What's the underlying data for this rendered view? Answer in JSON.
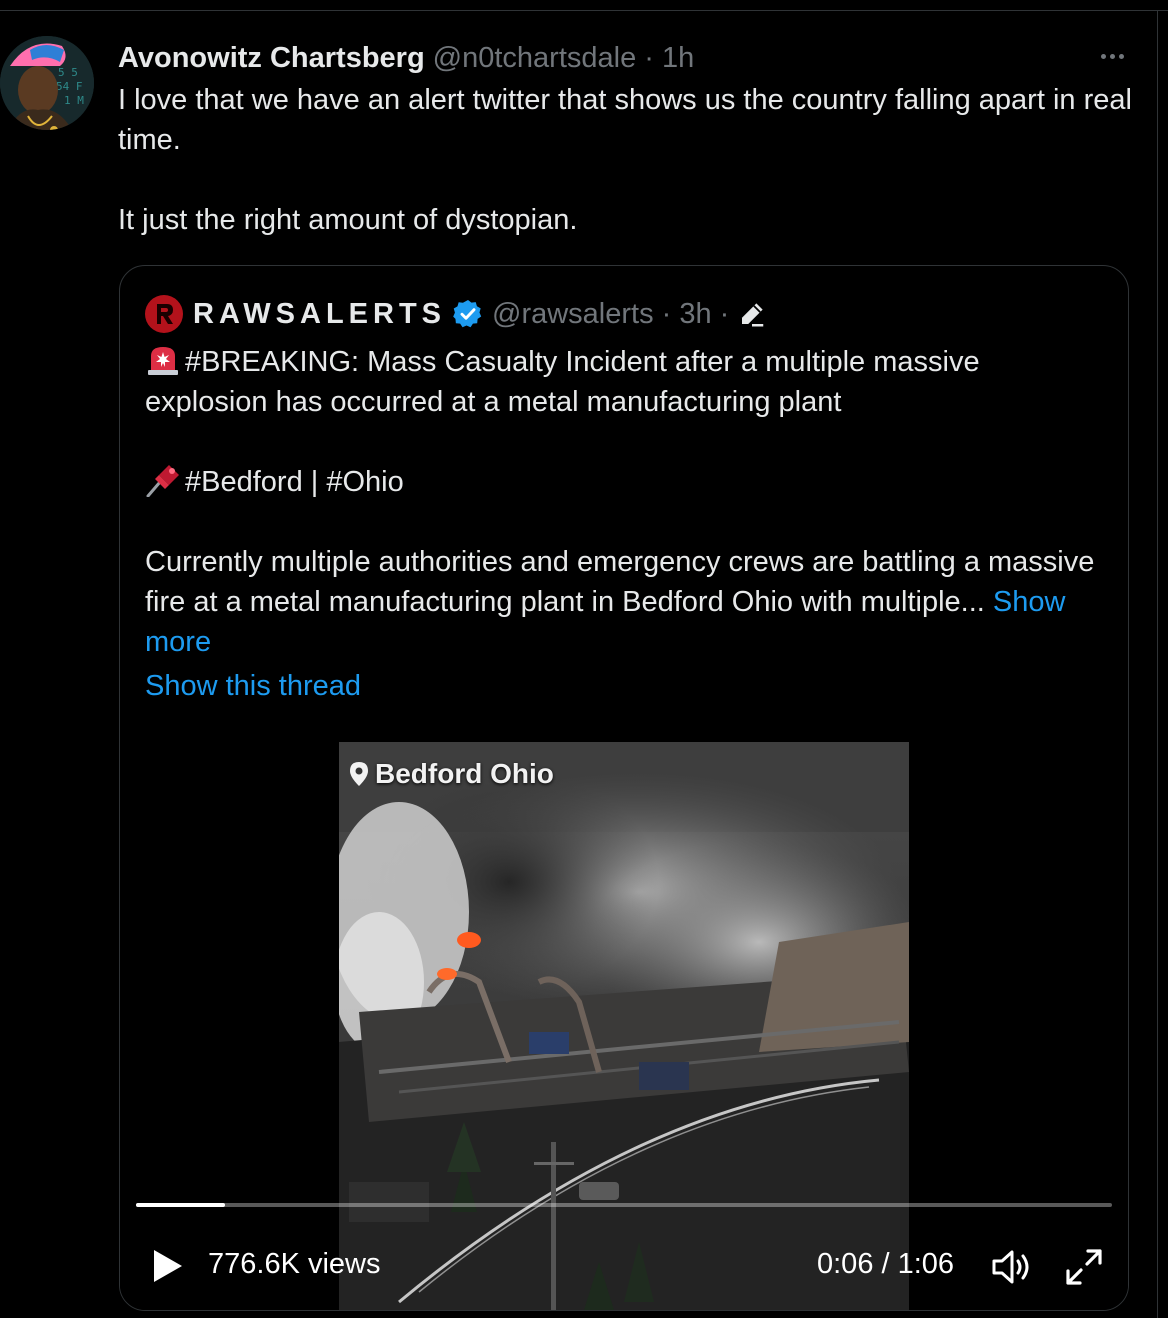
{
  "post": {
    "display_name": "Avonowitz Chartsberg",
    "handle_time": "@n0tchartsdale · 1h",
    "text_lines": [
      "I love that we have an alert twitter that shows us the country falling apart in real time.",
      "It just the right amount of dystopian."
    ]
  },
  "quote": {
    "name": "RAWSALERTS",
    "handle_time": "@rawsalerts · 3h ·",
    "line1": "#BREAKING: Mass Casualty Incident after a multiple massive explosion has occurred at a metal manufacturing plant",
    "line2": "#Bedford | #Ohio",
    "line3": "Currently multiple authorities and emergency crews are battling a massive fire at a metal manufacturing plant in Bedford Ohio with multiple...",
    "show_more": "Show more",
    "show_thread": "Show this thread"
  },
  "video": {
    "location_label": "Bedford Ohio",
    "views": "776.6K views",
    "time": "0:06 / 1:06",
    "progress": 0.091
  },
  "colors": {
    "link": "#1d9bf0",
    "muted": "#71767b",
    "text": "#e7e9ea",
    "verified": "#1d9bf0",
    "brand_logo": "#b3121b"
  },
  "icons": [
    "more-icon",
    "verified-icon",
    "edit-icon",
    "siren-icon",
    "pin-icon",
    "location-pin-icon",
    "play-icon",
    "volume-icon",
    "fullscreen-icon"
  ]
}
